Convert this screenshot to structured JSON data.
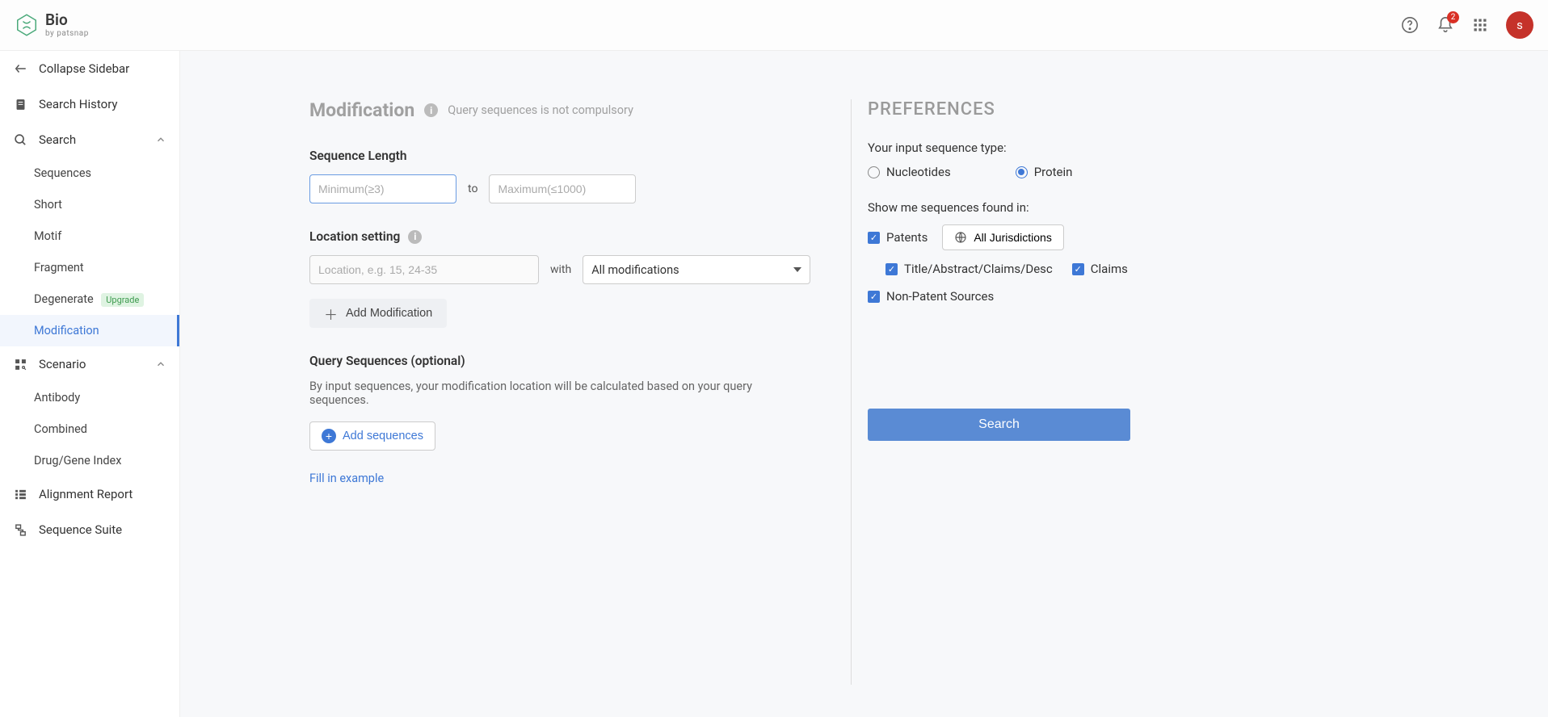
{
  "brand": {
    "name": "Bio",
    "sub": "by patsnap"
  },
  "header": {
    "notif_count": "2",
    "avatar_letter": "s"
  },
  "sidebar": {
    "collapse": "Collapse Sidebar",
    "history": "Search History",
    "search": "Search",
    "search_items": [
      "Sequences",
      "Short",
      "Motif",
      "Fragment",
      "Degenerate",
      "Modification"
    ],
    "upgrade": "Upgrade",
    "scenario": "Scenario",
    "scenario_items": [
      "Antibody",
      "Combined",
      "Drug/Gene Index"
    ],
    "alignment": "Alignment Report",
    "suite": "Sequence Suite"
  },
  "main": {
    "title": "Modification",
    "title_sub": "Query sequences is not compulsory",
    "seq_len_label": "Sequence Length",
    "min_ph": "Minimum(≥3)",
    "max_ph": "Maximum(≤1000)",
    "to": "to",
    "loc_label": "Location setting",
    "loc_ph": "Location, e.g. 15, 24-35",
    "with": "with",
    "mod_select": "All modifications",
    "add_mod": "Add Modification",
    "query_label": "Query Sequences (optional)",
    "query_desc": "By input sequences, your modification location will be calculated based on your query sequences.",
    "add_seq": "Add sequences",
    "fill": "Fill in example"
  },
  "pref": {
    "title": "PREFERENCES",
    "input_type_label": "Your input sequence type:",
    "nucleotides": "Nucleotides",
    "protein": "Protein",
    "found_in_label": "Show me sequences found in:",
    "patents": "Patents",
    "juris": "All Jurisdictions",
    "tacd": "Title/Abstract/Claims/Desc",
    "claims": "Claims",
    "nonpatent": "Non-Patent Sources",
    "search_btn": "Search"
  }
}
